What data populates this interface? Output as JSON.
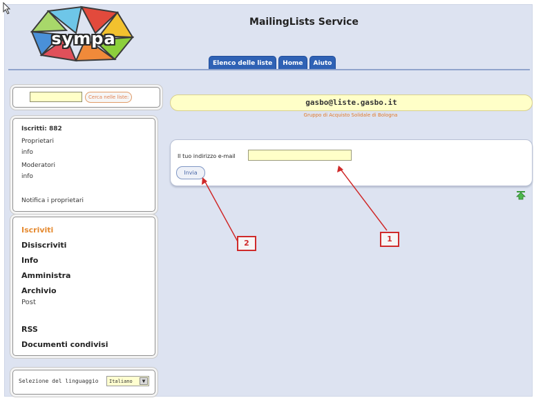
{
  "header": {
    "logo_text": "sympa",
    "service_title": "MailingLists Service",
    "tabs": [
      "Elenco delle liste",
      "Home",
      "Aiuto"
    ]
  },
  "sidebar": {
    "search_placeholder": "",
    "search_button": "Cerca nelle liste:",
    "info": {
      "subscribers": "Iscritti: 882",
      "owners_label": "Proprietari",
      "owners_value": "info",
      "moderators_label": "Moderatori",
      "moderators_value": "info",
      "notify": "Notifica i proprietari"
    },
    "menu": {
      "subscribe": "Iscriviti",
      "unsubscribe": "Disiscriviti",
      "info": "Info",
      "admin": "Amministra",
      "archive": "Archivio",
      "post": "Post",
      "rss": "RSS",
      "shared_docs": "Documenti condivisi"
    },
    "language": {
      "label": "Selezione del linguaggio",
      "selected": "Italiano"
    }
  },
  "main": {
    "list_address": "gasbo@liste.gasbo.it",
    "list_subtitle": "Gruppo di Acquisto Solidale di Bologna",
    "email_label": "Il tuo indirizzo e-mail",
    "email_value": "",
    "submit_label": "Invia"
  },
  "annotations": [
    "1",
    "2"
  ],
  "colors": {
    "background": "#dde3f1",
    "tab": "#2f62b5",
    "accent_orange": "#e58a30",
    "input_yellow": "#ffffc8",
    "annotation_red": "#cf2a2a"
  }
}
